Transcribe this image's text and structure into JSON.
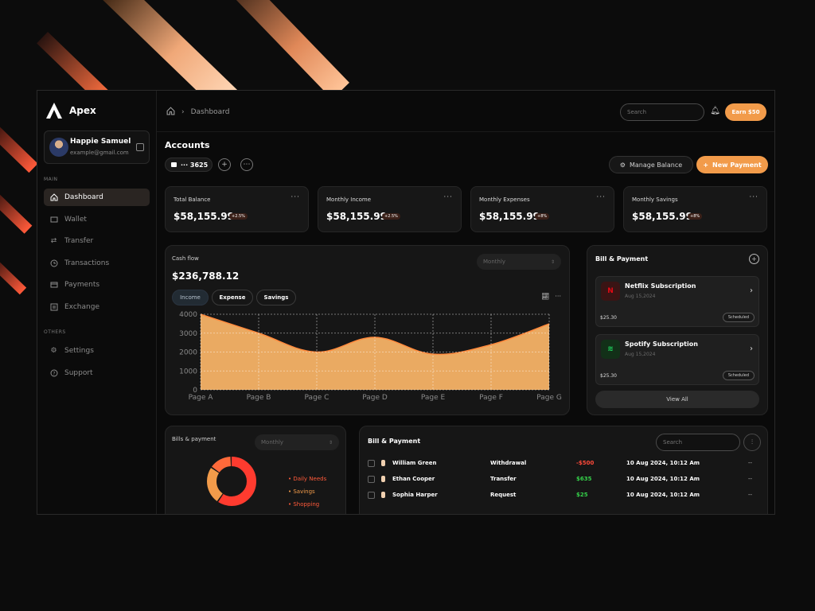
{
  "app": {
    "name": "Apex"
  },
  "profile": {
    "name": "Happie Samuel",
    "email": "example@gmail.com"
  },
  "sidebar": {
    "main_label": "MAIN",
    "items": [
      {
        "label": "Dashboard",
        "icon": "home-icon",
        "active": true
      },
      {
        "label": "Wallet",
        "icon": "wallet-icon"
      },
      {
        "label": "Transfer",
        "icon": "transfer-icon"
      },
      {
        "label": "Transactions",
        "icon": "clock-icon"
      },
      {
        "label": "Payments",
        "icon": "card-icon"
      },
      {
        "label": "Exchange",
        "icon": "exchange-icon"
      }
    ],
    "others_label": "OTHERS",
    "others": [
      {
        "label": "Settings",
        "icon": "gear-icon"
      },
      {
        "label": "Support",
        "icon": "support-icon"
      }
    ]
  },
  "header": {
    "breadcrumb": "Dashboard",
    "search_placeholder": "Search",
    "earn_label": "Earn $50"
  },
  "accounts": {
    "title": "Accounts",
    "card_last4": "··· 3625",
    "manage_label": "Manage Balance",
    "new_payment_label": "New Payment"
  },
  "stats": [
    {
      "label": "Total Balance",
      "value": "$58,155.99",
      "change": "+2.5%"
    },
    {
      "label": "Monthly Income",
      "value": "$58,155.99",
      "change": "+2.5%"
    },
    {
      "label": "Monthly Expenses",
      "value": "$58,155.99",
      "change": "+8%"
    },
    {
      "label": "Monthly Savings",
      "value": "$58,155.99",
      "change": "+8%"
    }
  ],
  "cashflow": {
    "label": "Cash flow",
    "value": "$236,788.12",
    "period": "Monthly",
    "tabs": [
      "Income",
      "Expense",
      "Savings"
    ]
  },
  "chart_data": {
    "type": "area",
    "categories": [
      "Page A",
      "Page B",
      "Page C",
      "Page D",
      "Page E",
      "Page F",
      "Page G"
    ],
    "values": [
      4000,
      3000,
      2000,
      2780,
      1890,
      2390,
      3490
    ],
    "ylim": [
      0,
      4000
    ],
    "yticks": [
      0,
      1000,
      2000,
      3000,
      4000
    ],
    "grid": true,
    "fill_color": "#f5b266",
    "line_color": "#ff8a3d"
  },
  "bill_payment": {
    "title": "Bill & Payment",
    "subscriptions": [
      {
        "name": "Netflix Subscription",
        "date": "Aug 15,2024",
        "amount": "$25.30",
        "status": "Scheduled",
        "logo": "N",
        "logo_bg": "#3a1414",
        "logo_color": "#e50914"
      },
      {
        "name": "Spotify Subscription",
        "date": "Aug 15,2024",
        "amount": "$25.30",
        "status": "Scheduled",
        "logo": "≋",
        "logo_bg": "#123018",
        "logo_color": "#1ed760"
      }
    ],
    "view_all": "View All"
  },
  "bills_small": {
    "title": "Bills & payment",
    "period": "Monthly",
    "legend": [
      "• Daily Needs",
      "• Savings",
      "• Shopping"
    ],
    "donut": [
      {
        "value": 60,
        "color": "#ff3b2f"
      },
      {
        "value": 25,
        "color": "#f29b4a"
      },
      {
        "value": 15,
        "color": "#ff6a3a"
      }
    ]
  },
  "transactions": {
    "title": "Bill & Payment",
    "search_placeholder": "Search",
    "rows": [
      {
        "name": "William Green",
        "type": "Withdrawal",
        "amount": "-$500",
        "amount_color": "#ff4a3a",
        "date": "10 Aug 2024, 10:12 Am",
        "more": "--"
      },
      {
        "name": "Ethan Cooper",
        "type": "Transfer",
        "amount": "$635",
        "amount_color": "#35d24a",
        "date": "10 Aug 2024, 10:12 Am",
        "more": "--"
      },
      {
        "name": "Sophia Harper",
        "type": "Request",
        "amount": "$25",
        "amount_color": "#35d24a",
        "date": "10 Aug 2024, 10:12 Am",
        "more": "--"
      }
    ]
  }
}
